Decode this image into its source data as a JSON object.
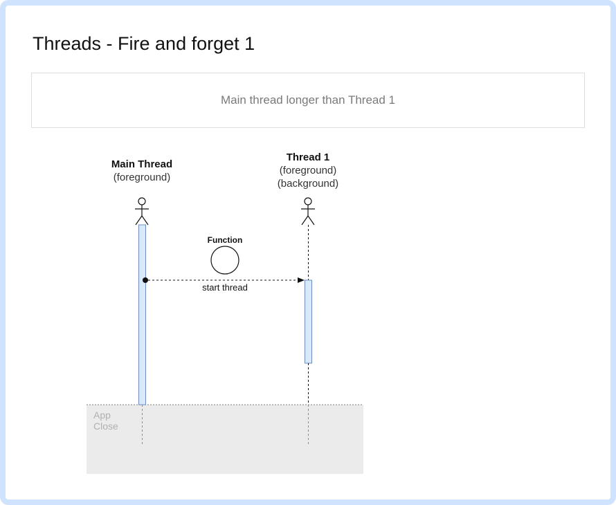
{
  "title": "Threads - Fire and forget 1",
  "note": "Main thread longer than Thread 1",
  "lifelines": {
    "main": {
      "name": "Main Thread",
      "sub1": "(foreground)"
    },
    "thread1": {
      "name": "Thread 1",
      "sub1": "(foreground)",
      "sub2": "(background)"
    }
  },
  "function_label": "Function",
  "message_label": "start thread",
  "app_close": {
    "line1": "App",
    "line2": "Close"
  },
  "colors": {
    "frame_border": "#cfe3ff",
    "activation_fill": "#dae8fc",
    "activation_stroke": "#6c8ebf",
    "app_close_fill": "#ebebeb",
    "app_close_text": "#b0b0b0"
  }
}
